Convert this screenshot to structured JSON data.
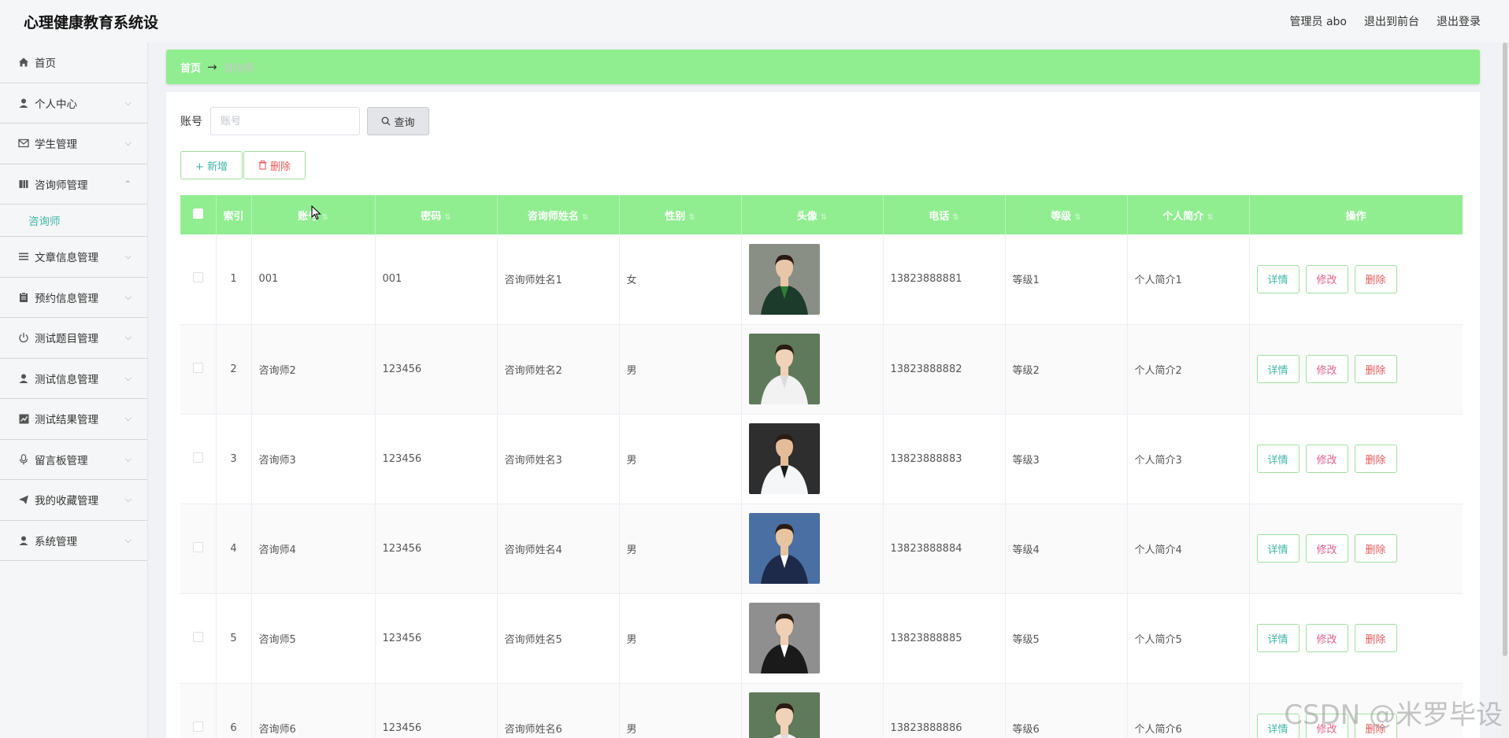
{
  "app": {
    "title": "心理健康教育系统设"
  },
  "topbar": {
    "admin": "管理员 abo",
    "to_front": "退出到前台",
    "logout": "退出登录"
  },
  "sidebar": {
    "items": [
      {
        "label": "首页",
        "icon": "home-icon",
        "expandable": false
      },
      {
        "label": "个人中心",
        "icon": "user-icon",
        "expandable": true
      },
      {
        "label": "学生管理",
        "icon": "mail-icon",
        "expandable": true
      },
      {
        "label": "咨询师管理",
        "icon": "book-icon",
        "expandable": true,
        "expanded": true
      },
      {
        "label": "文章信息管理",
        "icon": "list-icon",
        "expandable": true
      },
      {
        "label": "预约信息管理",
        "icon": "clipboard-icon",
        "expandable": true
      },
      {
        "label": "测试题目管理",
        "icon": "power-icon",
        "expandable": true
      },
      {
        "label": "测试信息管理",
        "icon": "person-icon",
        "expandable": true
      },
      {
        "label": "测试结果管理",
        "icon": "chart-icon",
        "expandable": true
      },
      {
        "label": "留言板管理",
        "icon": "mic-icon",
        "expandable": true
      },
      {
        "label": "我的收藏管理",
        "icon": "send-icon",
        "expandable": true
      },
      {
        "label": "系统管理",
        "icon": "user-icon",
        "expandable": true
      }
    ],
    "submenu": {
      "label": "咨询师"
    }
  },
  "breadcrumb": {
    "home": "首页",
    "arrow": "→",
    "current": "咨询师"
  },
  "search": {
    "label": "账号",
    "placeholder": "账号",
    "button": "查询"
  },
  "actions": {
    "add": "+ 新增",
    "delete": "删除"
  },
  "table": {
    "columns": [
      "索引",
      "账号",
      "密码",
      "咨询师姓名",
      "性别",
      "头像",
      "电话",
      "等级",
      "个人简介",
      "操作"
    ],
    "rows": [
      {
        "index": "1",
        "account": "001",
        "password": "001",
        "name": "咨询师姓名1",
        "gender": "女",
        "phone": "13823888881",
        "level": "等级1",
        "intro": "个人简介1"
      },
      {
        "index": "2",
        "account": "咨询师2",
        "password": "123456",
        "name": "咨询师姓名2",
        "gender": "男",
        "phone": "13823888882",
        "level": "等级2",
        "intro": "个人简介2"
      },
      {
        "index": "3",
        "account": "咨询师3",
        "password": "123456",
        "name": "咨询师姓名3",
        "gender": "男",
        "phone": "13823888883",
        "level": "等级3",
        "intro": "个人简介3"
      },
      {
        "index": "4",
        "account": "咨询师4",
        "password": "123456",
        "name": "咨询师姓名4",
        "gender": "男",
        "phone": "13823888884",
        "level": "等级4",
        "intro": "个人简介4"
      },
      {
        "index": "5",
        "account": "咨询师5",
        "password": "123456",
        "name": "咨询师姓名5",
        "gender": "男",
        "phone": "13823888885",
        "level": "等级5",
        "intro": "个人简介5"
      },
      {
        "index": "6",
        "account": "咨询师6",
        "password": "123456",
        "name": "咨询师姓名6",
        "gender": "男",
        "phone": "13823888886",
        "level": "等级6",
        "intro": "个人简介6"
      }
    ],
    "ops": {
      "detail": "详情",
      "edit": "修改",
      "delete": "删除"
    }
  },
  "watermark": "CSDN @米罗毕设",
  "colors": {
    "accent": "#90ee90",
    "teal": "#3fb6a8",
    "danger": "#e65a5a"
  }
}
